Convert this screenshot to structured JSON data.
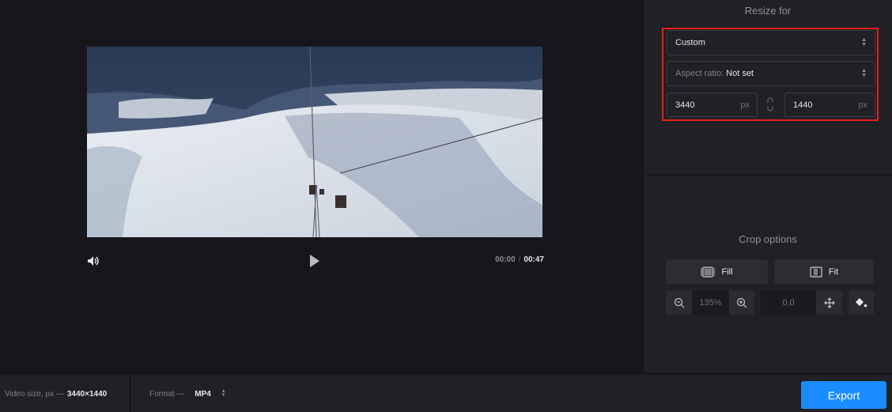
{
  "player": {
    "current_time": "00:00",
    "separator": "/",
    "duration": "00:47",
    "icons": {
      "volume": "speaker-icon",
      "play": "play-icon"
    }
  },
  "resize": {
    "title": "Resize for",
    "preset": "Custom",
    "aspect_label": "Aspect ratio:",
    "aspect_value": "Not set",
    "width": "3440",
    "height": "1440",
    "unit": "px",
    "highlight_color": "#e8201a"
  },
  "crop": {
    "title": "Crop options",
    "fill_label": "Fill",
    "fit_label": "Fit",
    "zoom_value": "135%",
    "position_value": "0,0"
  },
  "bottom": {
    "video_size_label": "Video size, px —",
    "video_size_value": "3440×1440",
    "format_label": "Format —",
    "format_value": "MP4",
    "export_label": "Export",
    "accent_color": "#1a8cff"
  }
}
